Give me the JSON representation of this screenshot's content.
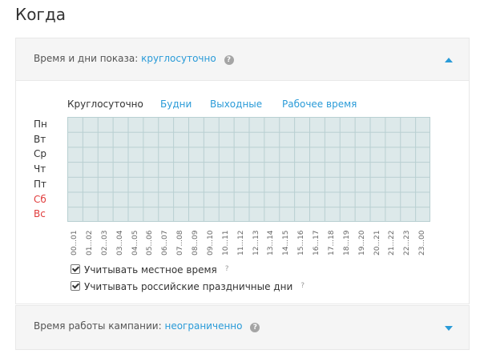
{
  "page": {
    "title": "Когда"
  },
  "time_section": {
    "label": "Время и дни показа:",
    "value": "круглосуточно",
    "help": "?",
    "presets": [
      {
        "label": "Круглосуточно",
        "active": true
      },
      {
        "label": "Будни",
        "active": false
      },
      {
        "label": "Выходные",
        "active": false
      },
      {
        "label": "Рабочее время",
        "active": false
      }
    ],
    "days": [
      {
        "label": "Пн",
        "weekend": false
      },
      {
        "label": "Вт",
        "weekend": false
      },
      {
        "label": "Ср",
        "weekend": false
      },
      {
        "label": "Чт",
        "weekend": false
      },
      {
        "label": "Пт",
        "weekend": false
      },
      {
        "label": "Сб",
        "weekend": true
      },
      {
        "label": "Вс",
        "weekend": true
      }
    ],
    "hours": [
      "00...01",
      "01...02",
      "02...03",
      "03...04",
      "04...05",
      "05...06",
      "06...07",
      "07...08",
      "08...09",
      "09...10",
      "10...11",
      "11...12",
      "12...13",
      "13...14",
      "14...15",
      "15...16",
      "16...17",
      "17...18",
      "18...19",
      "19...20",
      "20...21",
      "21...22",
      "22...23",
      "23...00"
    ],
    "options": [
      {
        "label": "Учитывать местное время",
        "checked": true,
        "help": "?"
      },
      {
        "label": "Учитывать российские праздничные дни",
        "checked": true,
        "help": "?"
      }
    ]
  },
  "campaign_section": {
    "label": "Время работы кампании:",
    "value": "неограниченно",
    "help": "?"
  },
  "colors": {
    "accent": "#2a9bd8",
    "weekend": "#e03c3c",
    "grid_fill": "#dde9ea"
  }
}
